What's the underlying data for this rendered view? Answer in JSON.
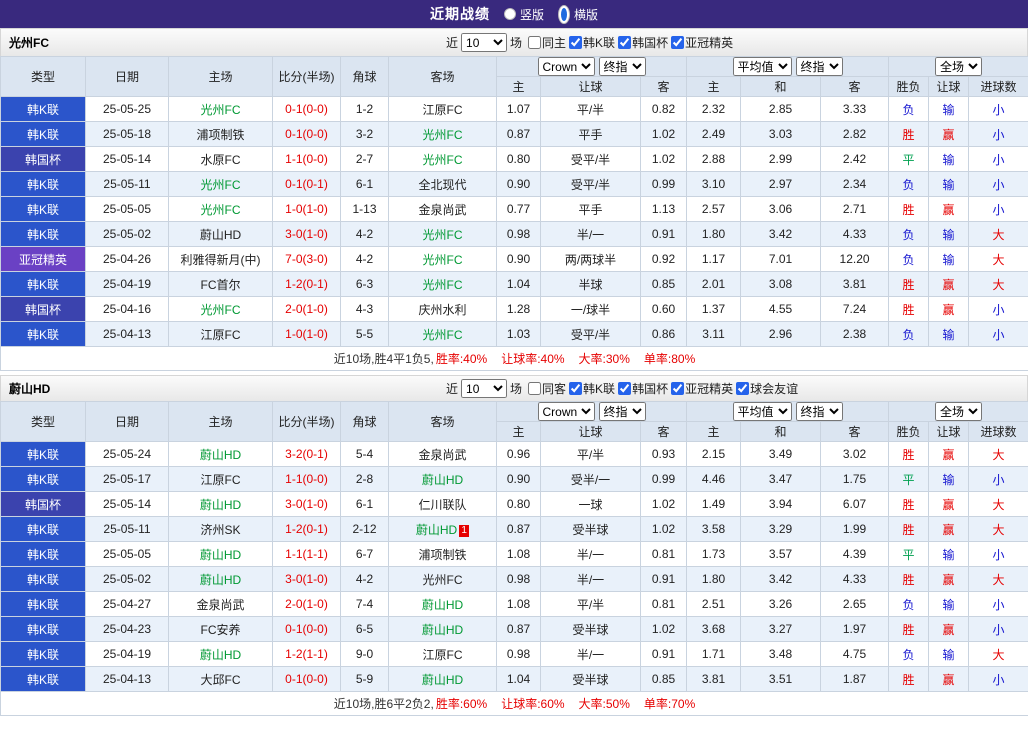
{
  "topbar": {
    "title": "近期战绩",
    "options": [
      {
        "label": "竖版",
        "selected": false
      },
      {
        "label": "横版",
        "selected": true
      }
    ]
  },
  "columns": {
    "left": [
      "类型",
      "日期",
      "主场",
      "比分(半场)",
      "角球",
      "客场"
    ],
    "odds_sub": [
      "主",
      "让球",
      "客"
    ],
    "avg_sub": [
      "主",
      "和",
      "客"
    ],
    "result_sub": [
      "胜负",
      "让球",
      "进球数"
    ]
  },
  "dropdowns": {
    "odds_source": "Crown",
    "odds_time": "终指",
    "avg_source": "平均值",
    "avg_time": "终指",
    "scope": "全场"
  },
  "colors": {
    "topbar": "#39297e",
    "league_kleague": "#2b55cb",
    "league_cup": "#3b43ae",
    "league_acl": "#6a41c4",
    "win_red": "#e60000",
    "draw_green": "#00a050",
    "lose_blue": "#1515d0",
    "focal_team_green": "#009933"
  },
  "tables": [
    {
      "team": "光州FC",
      "filter": {
        "near": "近",
        "count": "10",
        "unit": "场",
        "same": {
          "label": "同主",
          "checked": false
        },
        "leagues": [
          {
            "label": "韩K联",
            "checked": true
          },
          {
            "label": "韩国杯",
            "checked": true
          },
          {
            "label": "亚冠精英",
            "checked": true
          }
        ]
      },
      "rows": [
        {
          "type": "韩K联",
          "date": "25-05-25",
          "home": "光州FC",
          "home_focal": true,
          "score": "0-1(0-0)",
          "corner": "1-2",
          "away": "江原FC",
          "odds": [
            "1.07",
            "平/半",
            "0.82"
          ],
          "avg": [
            "2.32",
            "2.85",
            "3.33"
          ],
          "results": [
            "负",
            "输",
            "小"
          ]
        },
        {
          "type": "韩K联",
          "date": "25-05-18",
          "home": "浦项制铁",
          "score": "0-1(0-0)",
          "corner": "3-2",
          "away": "光州FC",
          "away_focal": true,
          "odds": [
            "0.87",
            "平手",
            "1.02"
          ],
          "avg": [
            "2.49",
            "3.03",
            "2.82"
          ],
          "results": [
            "胜",
            "赢",
            "小"
          ]
        },
        {
          "type": "韩国杯",
          "date": "25-05-14",
          "home": "水原FC",
          "score": "1-1(0-0)",
          "corner": "2-7",
          "away": "光州FC",
          "away_focal": true,
          "odds": [
            "0.80",
            "受平/半",
            "1.02"
          ],
          "avg": [
            "2.88",
            "2.99",
            "2.42"
          ],
          "results": [
            "平",
            "输",
            "小"
          ]
        },
        {
          "type": "韩K联",
          "date": "25-05-11",
          "home": "光州FC",
          "home_focal": true,
          "score": "0-1(0-1)",
          "corner": "6-1",
          "away": "全北现代",
          "odds": [
            "0.90",
            "受平/半",
            "0.99"
          ],
          "avg": [
            "3.10",
            "2.97",
            "2.34"
          ],
          "results": [
            "负",
            "输",
            "小"
          ]
        },
        {
          "type": "韩K联",
          "date": "25-05-05",
          "home": "光州FC",
          "home_focal": true,
          "score": "1-0(1-0)",
          "corner": "1-13",
          "away": "金泉尚武",
          "odds": [
            "0.77",
            "平手",
            "1.13"
          ],
          "avg": [
            "2.57",
            "3.06",
            "2.71"
          ],
          "results": [
            "胜",
            "赢",
            "小"
          ]
        },
        {
          "type": "韩K联",
          "date": "25-05-02",
          "home": "蔚山HD",
          "score": "3-0(1-0)",
          "corner": "4-2",
          "away": "光州FC",
          "away_focal": true,
          "odds": [
            "0.98",
            "半/一",
            "0.91"
          ],
          "avg": [
            "1.80",
            "3.42",
            "4.33"
          ],
          "results": [
            "负",
            "输",
            "大"
          ]
        },
        {
          "type": "亚冠精英",
          "date": "25-04-26",
          "home": "利雅得新月(中)",
          "score": "7-0(3-0)",
          "corner": "4-2",
          "away": "光州FC",
          "away_focal": true,
          "odds": [
            "0.90",
            "两/两球半",
            "0.92"
          ],
          "avg": [
            "1.17",
            "7.01",
            "12.20"
          ],
          "results": [
            "负",
            "输",
            "大"
          ]
        },
        {
          "type": "韩K联",
          "date": "25-04-19",
          "home": "FC首尔",
          "score": "1-2(0-1)",
          "corner": "6-3",
          "away": "光州FC",
          "away_focal": true,
          "odds": [
            "1.04",
            "半球",
            "0.85"
          ],
          "avg": [
            "2.01",
            "3.08",
            "3.81"
          ],
          "results": [
            "胜",
            "赢",
            "大"
          ]
        },
        {
          "type": "韩国杯",
          "date": "25-04-16",
          "home": "光州FC",
          "home_focal": true,
          "score": "2-0(1-0)",
          "corner": "4-3",
          "away": "庆州水利",
          "odds": [
            "1.28",
            "一/球半",
            "0.60"
          ],
          "avg": [
            "1.37",
            "4.55",
            "7.24"
          ],
          "results": [
            "胜",
            "赢",
            "小"
          ]
        },
        {
          "type": "韩K联",
          "date": "25-04-13",
          "home": "江原FC",
          "score": "1-0(1-0)",
          "corner": "5-5",
          "away": "光州FC",
          "away_focal": true,
          "odds": [
            "1.03",
            "受平/半",
            "0.86"
          ],
          "avg": [
            "3.11",
            "2.96",
            "2.38"
          ],
          "results": [
            "负",
            "输",
            "小"
          ]
        }
      ],
      "summary": {
        "prefix": "近10场,胜4平1负5,",
        "stats": [
          "胜率:40%",
          "让球率:40%",
          "大率:30%",
          "单率:80%"
        ]
      }
    },
    {
      "team": "蔚山HD",
      "filter": {
        "near": "近",
        "count": "10",
        "unit": "场",
        "same": {
          "label": "同客",
          "checked": false
        },
        "leagues": [
          {
            "label": "韩K联",
            "checked": true
          },
          {
            "label": "韩国杯",
            "checked": true
          },
          {
            "label": "亚冠精英",
            "checked": true
          },
          {
            "label": "球会友谊",
            "checked": true
          }
        ]
      },
      "rows": [
        {
          "type": "韩K联",
          "date": "25-05-24",
          "home": "蔚山HD",
          "home_focal": true,
          "score": "3-2(0-1)",
          "corner": "5-4",
          "away": "金泉尚武",
          "odds": [
            "0.96",
            "平/半",
            "0.93"
          ],
          "avg": [
            "2.15",
            "3.49",
            "3.02"
          ],
          "results": [
            "胜",
            "赢",
            "大"
          ]
        },
        {
          "type": "韩K联",
          "date": "25-05-17",
          "home": "江原FC",
          "score": "1-1(0-0)",
          "corner": "2-8",
          "away": "蔚山HD",
          "away_focal": true,
          "odds": [
            "0.90",
            "受半/一",
            "0.99"
          ],
          "avg": [
            "4.46",
            "3.47",
            "1.75"
          ],
          "results": [
            "平",
            "输",
            "小"
          ]
        },
        {
          "type": "韩国杯",
          "date": "25-05-14",
          "home": "蔚山HD",
          "home_focal": true,
          "score": "3-0(1-0)",
          "corner": "6-1",
          "away": "仁川联队",
          "odds": [
            "0.80",
            "一球",
            "1.02"
          ],
          "avg": [
            "1.49",
            "3.94",
            "6.07"
          ],
          "results": [
            "胜",
            "赢",
            "大"
          ]
        },
        {
          "type": "韩K联",
          "date": "25-05-11",
          "home": "济州SK",
          "score": "1-2(0-1)",
          "corner": "2-12",
          "away": "蔚山HD",
          "away_focal": true,
          "away_card": "1",
          "odds": [
            "0.87",
            "受半球",
            "1.02"
          ],
          "avg": [
            "3.58",
            "3.29",
            "1.99"
          ],
          "results": [
            "胜",
            "赢",
            "大"
          ]
        },
        {
          "type": "韩K联",
          "date": "25-05-05",
          "home": "蔚山HD",
          "home_focal": true,
          "score": "1-1(1-1)",
          "corner": "6-7",
          "away": "浦项制铁",
          "odds": [
            "1.08",
            "半/一",
            "0.81"
          ],
          "avg": [
            "1.73",
            "3.57",
            "4.39"
          ],
          "results": [
            "平",
            "输",
            "小"
          ]
        },
        {
          "type": "韩K联",
          "date": "25-05-02",
          "home": "蔚山HD",
          "home_focal": true,
          "score": "3-0(1-0)",
          "corner": "4-2",
          "away": "光州FC",
          "odds": [
            "0.98",
            "半/一",
            "0.91"
          ],
          "avg": [
            "1.80",
            "3.42",
            "4.33"
          ],
          "results": [
            "胜",
            "赢",
            "大"
          ]
        },
        {
          "type": "韩K联",
          "date": "25-04-27",
          "home": "金泉尚武",
          "score": "2-0(1-0)",
          "corner": "7-4",
          "away": "蔚山HD",
          "away_focal": true,
          "odds": [
            "1.08",
            "平/半",
            "0.81"
          ],
          "avg": [
            "2.51",
            "3.26",
            "2.65"
          ],
          "results": [
            "负",
            "输",
            "小"
          ]
        },
        {
          "type": "韩K联",
          "date": "25-04-23",
          "home": "FC安养",
          "score": "0-1(0-0)",
          "corner": "6-5",
          "away": "蔚山HD",
          "away_focal": true,
          "odds": [
            "0.87",
            "受半球",
            "1.02"
          ],
          "avg": [
            "3.68",
            "3.27",
            "1.97"
          ],
          "results": [
            "胜",
            "赢",
            "小"
          ]
        },
        {
          "type": "韩K联",
          "date": "25-04-19",
          "home": "蔚山HD",
          "home_focal": true,
          "score": "1-2(1-1)",
          "corner": "9-0",
          "away": "江原FC",
          "odds": [
            "0.98",
            "半/一",
            "0.91"
          ],
          "avg": [
            "1.71",
            "3.48",
            "4.75"
          ],
          "results": [
            "负",
            "输",
            "大"
          ]
        },
        {
          "type": "韩K联",
          "date": "25-04-13",
          "home": "大邱FC",
          "score": "0-1(0-0)",
          "corner": "5-9",
          "away": "蔚山HD",
          "away_focal": true,
          "odds": [
            "1.04",
            "受半球",
            "0.85"
          ],
          "avg": [
            "3.81",
            "3.51",
            "1.87"
          ],
          "results": [
            "胜",
            "赢",
            "小"
          ]
        }
      ],
      "summary": {
        "prefix": "近10场,胜6平2负2,",
        "stats": [
          "胜率:60%",
          "让球率:60%",
          "大率:50%",
          "单率:70%"
        ]
      }
    }
  ]
}
